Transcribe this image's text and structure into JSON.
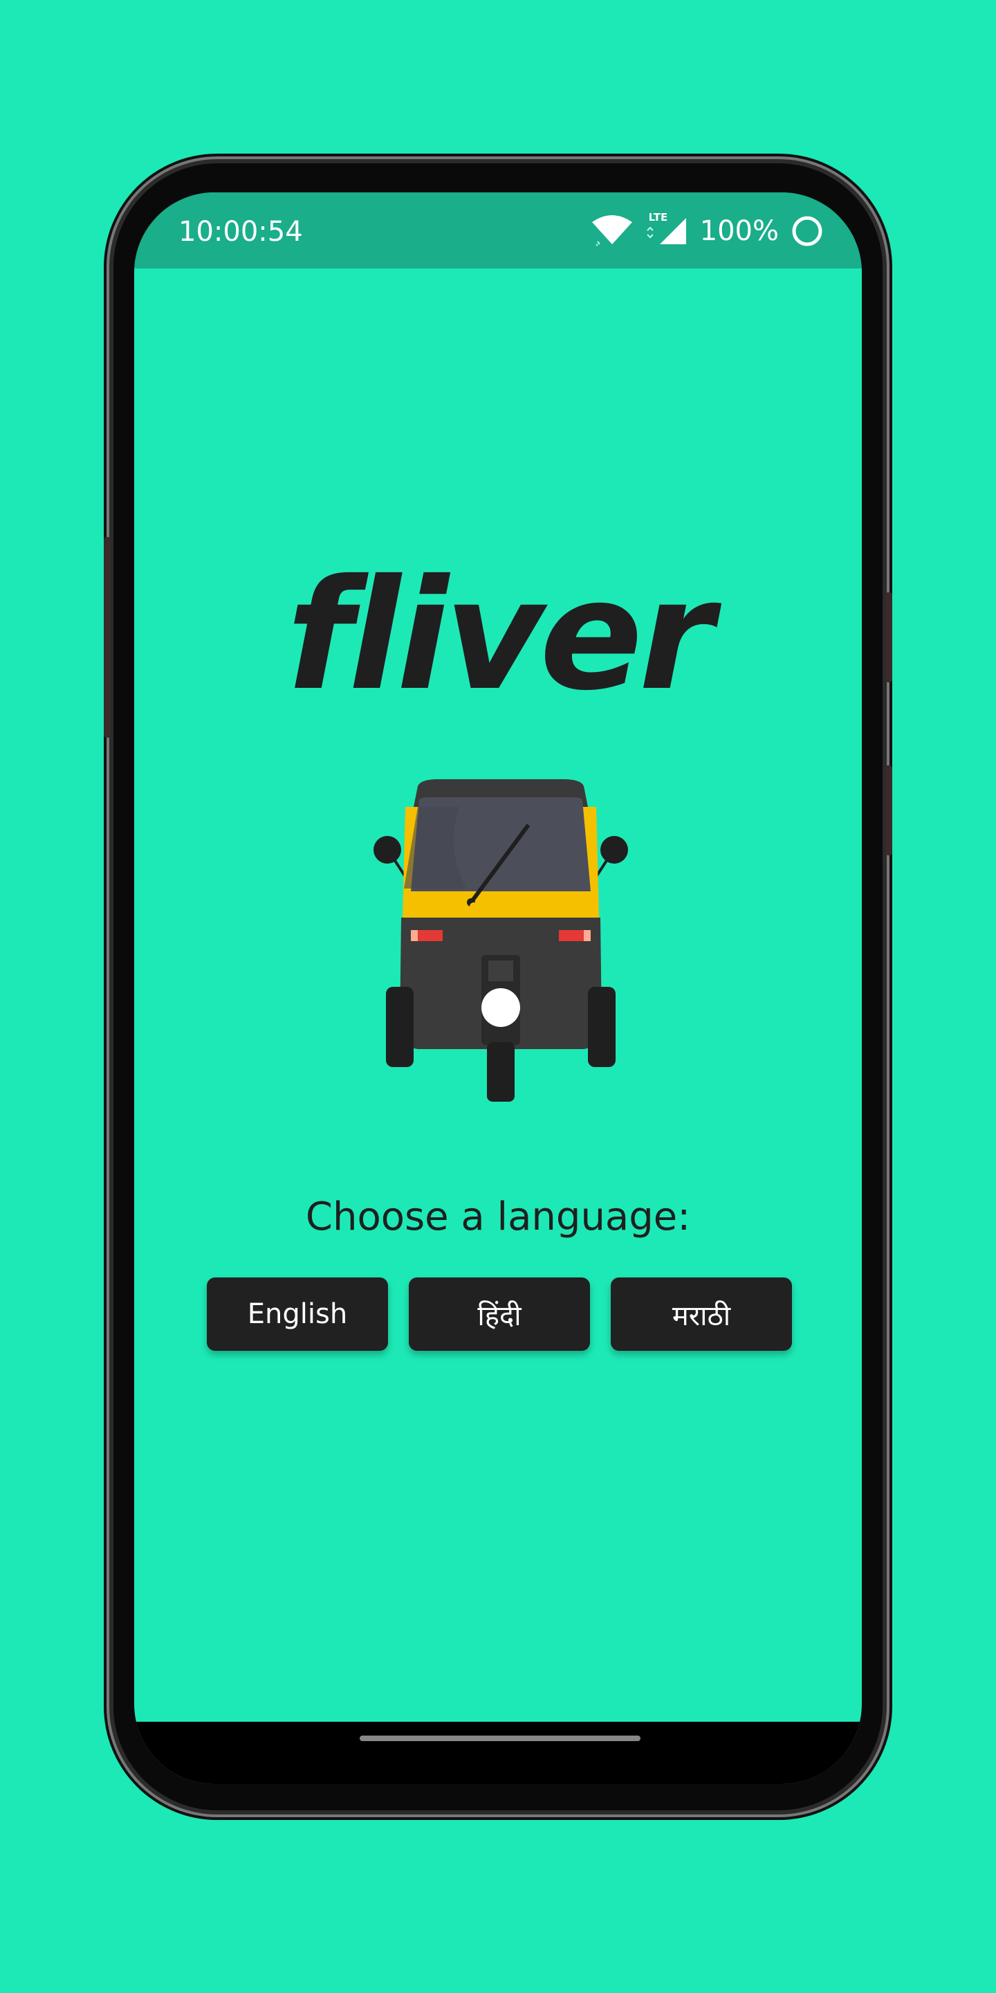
{
  "status_bar": {
    "time": "10:00:54",
    "network_label": "LTE",
    "battery_percent": "100%",
    "icons": [
      "wifi-icon",
      "signal-icon",
      "battery-ring-icon"
    ]
  },
  "logo": {
    "text": "fliver"
  },
  "illustration": {
    "icon": "auto-rickshaw-icon"
  },
  "language_prompt": "Choose a language:",
  "languages": [
    {
      "label": "English"
    },
    {
      "label": "हिंदी"
    },
    {
      "label": "मराठी"
    }
  ],
  "colors": {
    "background": "#1de9b6",
    "status_bar": "#1aae8a",
    "button": "#212121",
    "rickshaw_yellow": "#f5c000"
  }
}
